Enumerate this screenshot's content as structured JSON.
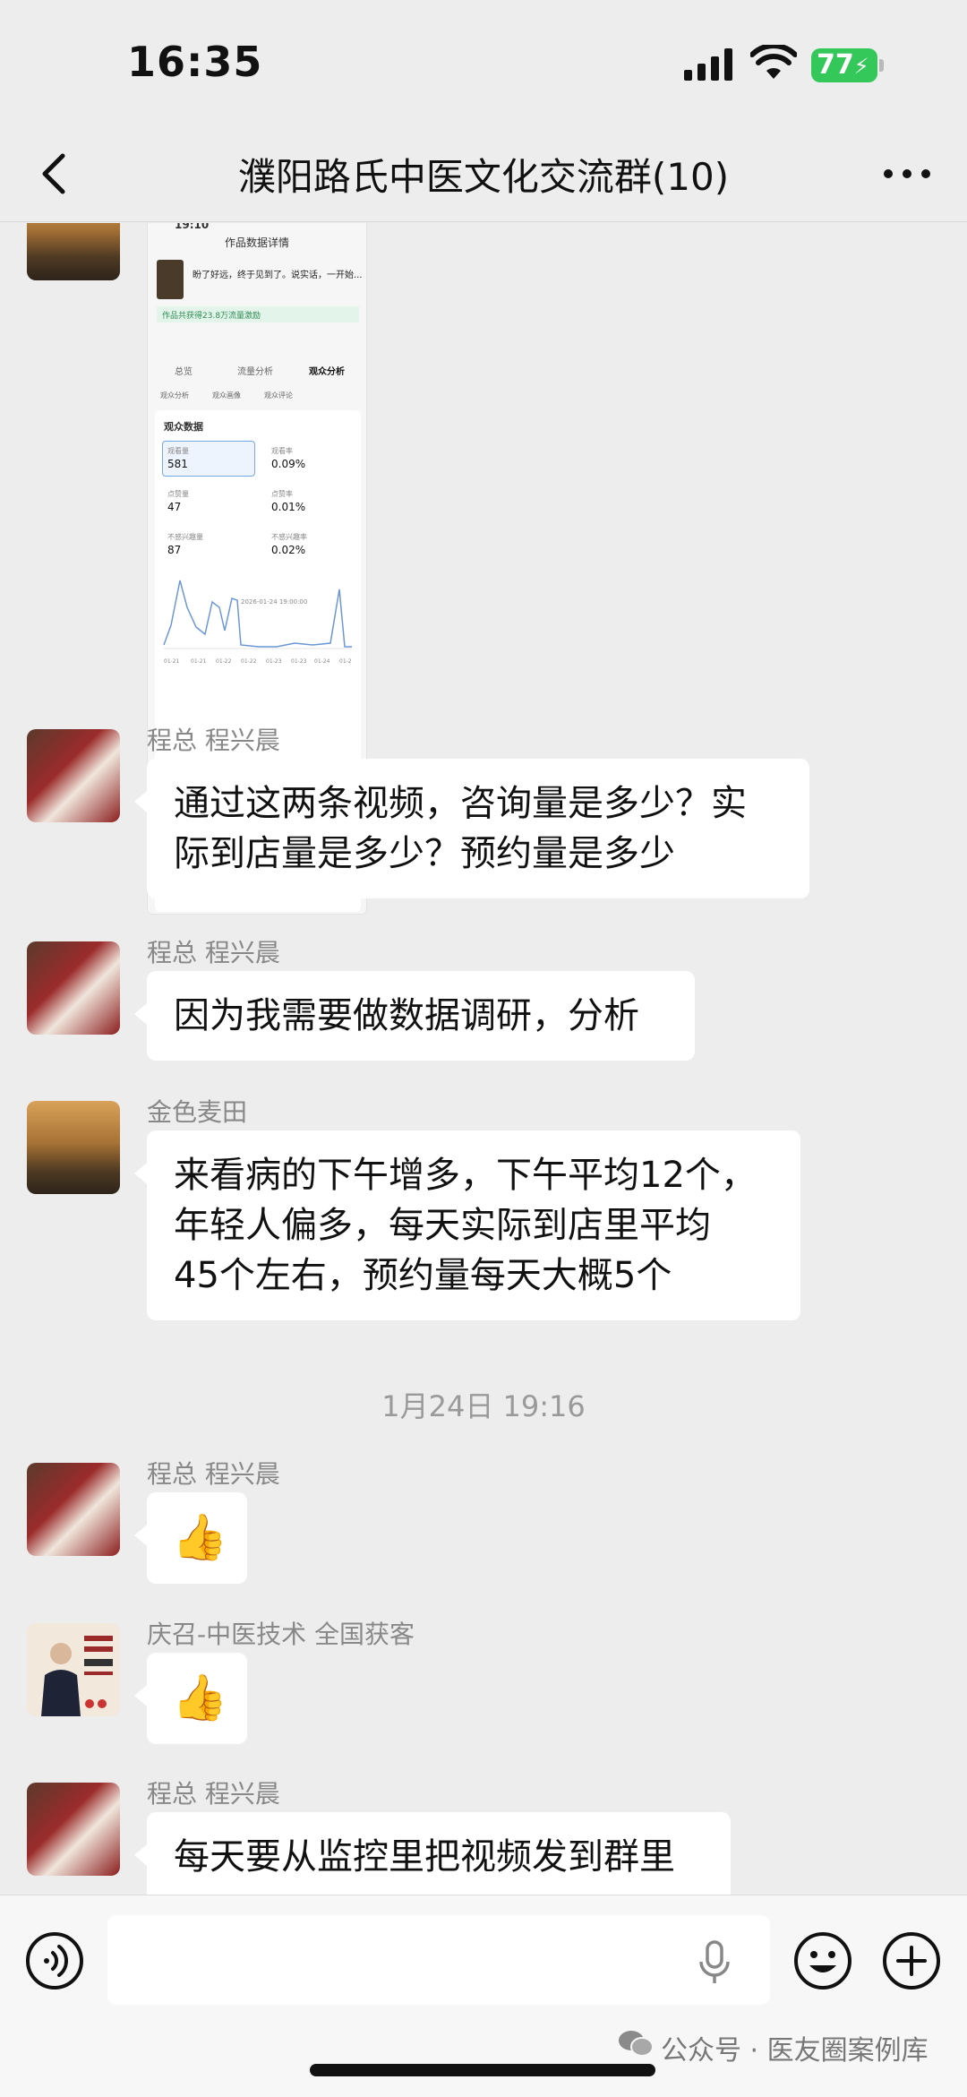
{
  "status_bar": {
    "time": "16:35",
    "battery": "77"
  },
  "header": {
    "title": "濮阳路氏中医文化交流群(10)"
  },
  "shared_screenshot": {
    "time": "19:10",
    "title": "作品数据详情",
    "caption": "盼了好远，终于见到了。说实话，一开始...",
    "green_note": "作品共获得23.8万流量激励",
    "tabs": [
      "总览",
      "流量分析",
      "观众分析"
    ],
    "subtabs": [
      "观众分析",
      "观众画像",
      "观众评论"
    ],
    "card_title": "观众数据",
    "metrics": [
      {
        "label": "观看量",
        "value": "581"
      },
      {
        "label": "观看率",
        "value": "0.09%"
      },
      {
        "label": "点赞量",
        "value": "47"
      },
      {
        "label": "点赞率",
        "value": "0.01%"
      },
      {
        "label": "不感兴趣量",
        "value": "87"
      },
      {
        "label": "不感兴趣率",
        "value": "0.02%"
      }
    ],
    "chart_tooltip": "2026-01-24 19:00:00",
    "chart_x": [
      "01-21",
      "01-21",
      "01-22",
      "01-22",
      "01-23",
      "01-23",
      "01-24",
      "01-2"
    ]
  },
  "messages": [
    {
      "sender": "程总 程兴晨",
      "lines": [
        "通过这两条视频，咨询量是多少？实",
        "际到店量是多少？预约量是多少"
      ]
    },
    {
      "sender": "程总 程兴晨",
      "lines": [
        "因为我需要做数据调研，分析"
      ]
    },
    {
      "sender": "金色麦田",
      "lines": [
        "来看病的下午增多，下午平均12个，",
        "年轻人偏多，每天实际到店里平均",
        "45个左右，预约量每天大概5个"
      ]
    },
    {
      "sender": "程总 程兴晨",
      "lines": [
        "👍"
      ]
    },
    {
      "sender": "庆召-中医技术  全国获客",
      "lines": [
        "👍"
      ]
    },
    {
      "sender": "程总 程兴晨",
      "lines": [
        "每天要从监控里把视频发到群里"
      ]
    }
  ],
  "timestamp": "1月24日 19:16",
  "watermark": "公众号 · 医友圈案例库"
}
